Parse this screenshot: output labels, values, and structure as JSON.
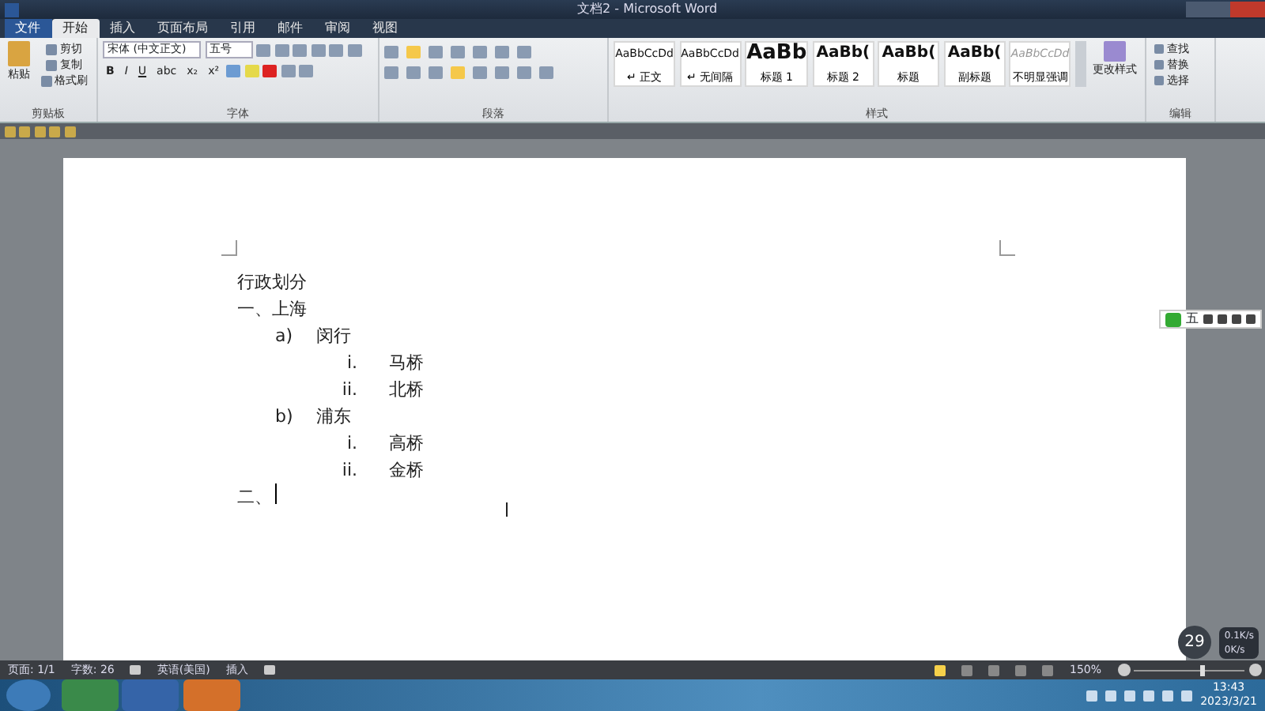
{
  "window": {
    "title": "文档2 - Microsoft Word"
  },
  "tabs": [
    {
      "label": "文件",
      "kind": "file",
      "selected": false
    },
    {
      "label": "开始",
      "kind": "tab",
      "selected": true
    },
    {
      "label": "插入",
      "kind": "tab",
      "selected": false
    },
    {
      "label": "页面布局",
      "kind": "tab",
      "selected": false
    },
    {
      "label": "引用",
      "kind": "tab",
      "selected": false
    },
    {
      "label": "邮件",
      "kind": "tab",
      "selected": false
    },
    {
      "label": "审阅",
      "kind": "tab",
      "selected": false
    },
    {
      "label": "视图",
      "kind": "tab",
      "selected": false
    }
  ],
  "clipboard": {
    "paste": "粘贴",
    "cut": "剪切",
    "copy": "复制",
    "format_painter": "格式刷",
    "group": "剪贴板"
  },
  "font": {
    "name": "宋体 (中文正文)",
    "size": "五号",
    "format_buttons": [
      "B",
      "I",
      "U",
      "abc",
      "x₂",
      "x²"
    ],
    "group": "字体"
  },
  "paragraph": {
    "group": "段落"
  },
  "styles": {
    "items": [
      {
        "preview": "AaBbCcDd",
        "name": "正文",
        "prefix": "↵",
        "kind": "small"
      },
      {
        "preview": "AaBbCcDd",
        "name": "无间隔",
        "prefix": "↵",
        "kind": "small"
      },
      {
        "preview": "AaBb",
        "name": "标题 1",
        "kind": "large"
      },
      {
        "preview": "AaBb(",
        "name": "标题 2",
        "kind": "medium"
      },
      {
        "preview": "AaBb(",
        "name": "标题",
        "kind": "medium"
      },
      {
        "preview": "AaBb(",
        "name": "副标题",
        "kind": "medium"
      },
      {
        "preview": "AaBbCcDd",
        "name": "不明显强调",
        "kind": "faint"
      }
    ],
    "change_styles": "更改样式",
    "group": "样式"
  },
  "editing": {
    "find": "查找",
    "replace": "替换",
    "select": "选择",
    "group": "编辑"
  },
  "document": {
    "lines": [
      {
        "text": "行政划分"
      },
      {
        "marker": "一、",
        "text": "上海",
        "children": [
          {
            "marker": "a)",
            "text": "闵行",
            "children": [
              {
                "marker": "i.",
                "text": "马桥"
              },
              {
                "marker": "ii.",
                "text": "北桥"
              }
            ]
          },
          {
            "marker": "b)",
            "text": "浦东",
            "children": [
              {
                "marker": "i.",
                "text": "高桥"
              },
              {
                "marker": "ii.",
                "text": "金桥"
              }
            ]
          }
        ]
      },
      {
        "marker": "二、",
        "cursor": true
      }
    ]
  },
  "ime_bar": {
    "mode": "五"
  },
  "status_bar": {
    "page": "页面: 1/1",
    "words": "字数: 26",
    "language": "英语(美国)",
    "mode": "插入",
    "zoom": "150%",
    "zoom_slider": {
      "level": 0.6
    }
  },
  "speed_widget": {
    "percent": "29",
    "up": "0.1K/s",
    "down": "0K/s"
  },
  "taskbar": {
    "time": "13:43",
    "date": "2023/3/21"
  }
}
